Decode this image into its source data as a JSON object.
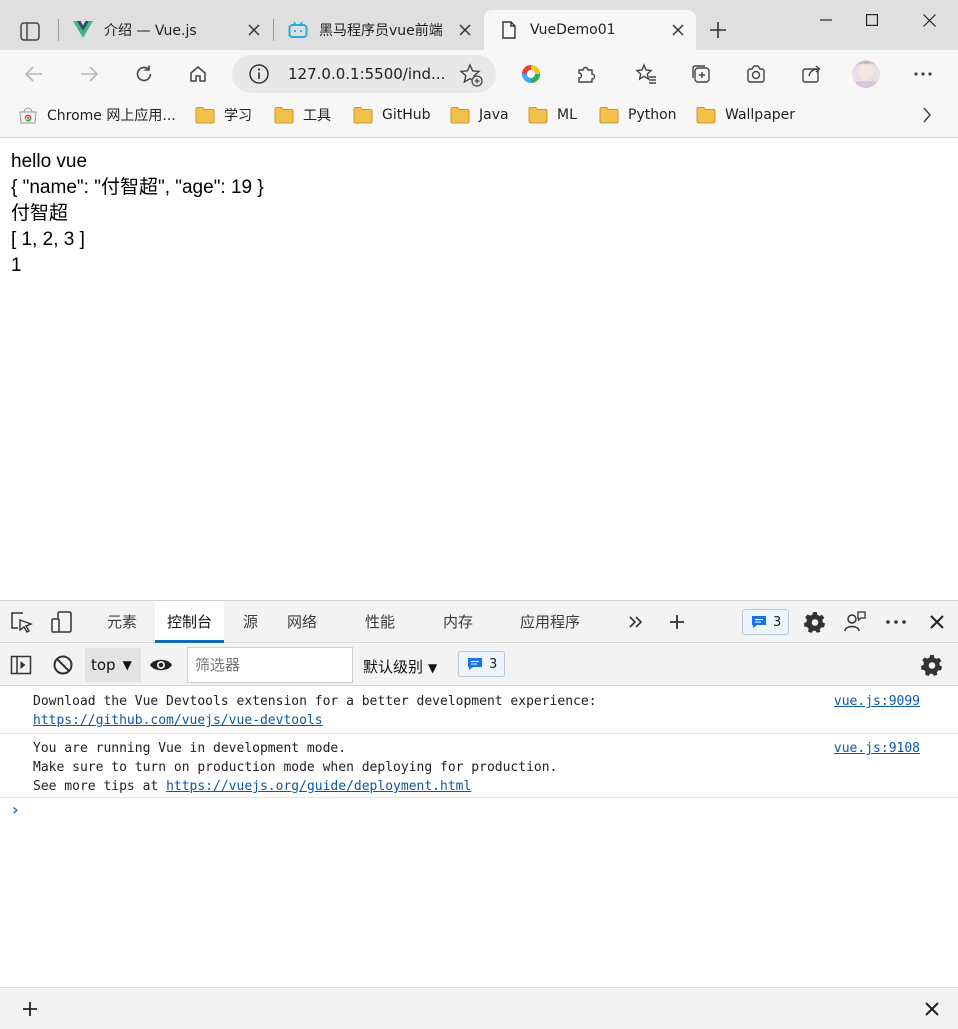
{
  "browser": {
    "tabs": [
      {
        "title": "介绍 — Vue.js",
        "favicon": "vue-logo-icon"
      },
      {
        "title": "黑马程序员vue前端",
        "favicon": "bilibili-icon"
      },
      {
        "title": "VueDemo01",
        "favicon": "page-icon",
        "active": true
      }
    ],
    "address": {
      "url": "127.0.0.1:5500/ind..."
    },
    "bookmarks": [
      {
        "label": "Chrome 网上应用...",
        "icon": "chrome-webstore-icon"
      },
      {
        "label": "学习",
        "icon": "folder-icon"
      },
      {
        "label": "工具",
        "icon": "folder-icon"
      },
      {
        "label": "GitHub",
        "icon": "folder-icon"
      },
      {
        "label": "Java",
        "icon": "folder-icon"
      },
      {
        "label": "ML",
        "icon": "folder-icon"
      },
      {
        "label": "Python",
        "icon": "folder-icon"
      },
      {
        "label": "Wallpaper",
        "icon": "folder-icon"
      }
    ]
  },
  "page": {
    "lines": [
      "hello vue",
      "{ \"name\": \"付智超\", \"age\": 19 }",
      "付智超",
      "[ 1, 2, 3 ]",
      "1"
    ]
  },
  "devtools": {
    "tabs": [
      "元素",
      "控制台",
      "源",
      "网络",
      "性能",
      "内存",
      "应用程序"
    ],
    "active_tab": "控制台",
    "message_count": "3",
    "context": "top",
    "filter_placeholder": "筛选器",
    "levels": "默认级别",
    "messages": [
      {
        "lines": [
          "Download the Vue Devtools extension for a better development experience:"
        ],
        "link": "https://github.com/vuejs/vue-devtools",
        "source": "vue.js:9099"
      },
      {
        "lines": [
          "You are running Vue in development mode.",
          "Make sure to turn on production mode when deploying for production."
        ],
        "prefix": "See more tips at ",
        "link": "https://vuejs.org/guide/deployment.html",
        "source": "vue.js:9108"
      }
    ],
    "prompt": "›"
  },
  "colors": {
    "accent": "#0f6cbd",
    "link": "#0b57a4",
    "vue_green": "#41b883",
    "folder": "#f2c14b"
  }
}
